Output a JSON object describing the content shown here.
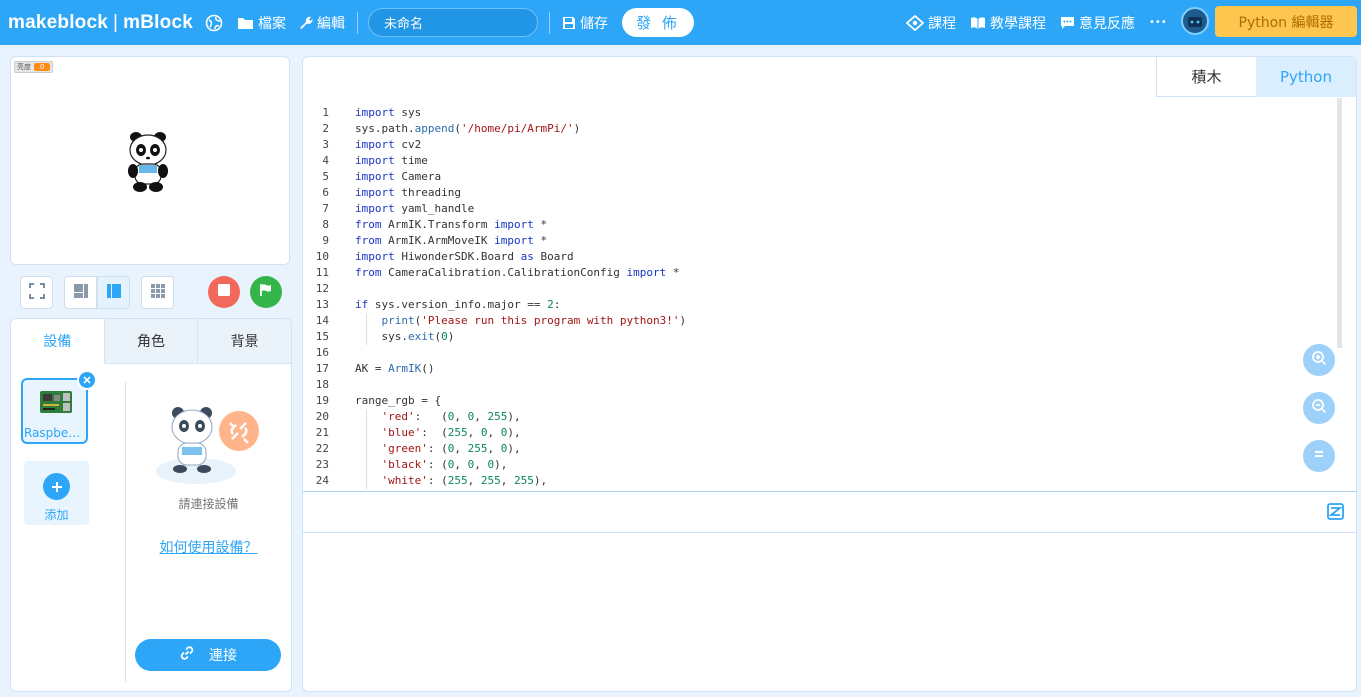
{
  "topbar": {
    "logo_brand": "makeblock",
    "logo_separator": "|",
    "logo_product": "mBlock",
    "file_label": "檔案",
    "edit_label": "編輯",
    "project_name": "未命名",
    "save_label": "儲存",
    "publish_label": "發 佈",
    "courses_label": "課程",
    "tutorials_label": "教學課程",
    "feedback_label": "意見反應",
    "more_label": "•••",
    "python_editor_label": "Python 編輯器",
    "accent_color": "#2ea6f7",
    "python_button_color": "#fcc64f"
  },
  "stage": {
    "variable_name": "亮度",
    "variable_value": "0"
  },
  "device_panel": {
    "tabs": [
      {
        "label": "設備",
        "active": true
      },
      {
        "label": "角色",
        "active": false
      },
      {
        "label": "背景",
        "active": false
      }
    ],
    "device_name": "Raspberr...",
    "add_label": "添加",
    "connect_hint": "請連接設備",
    "howto_link": "如何使用設備？",
    "connect_button": "連接"
  },
  "code_panel": {
    "mode_tabs": [
      "積木",
      "Python"
    ],
    "active_mode": "Python",
    "lines": [
      {
        "n": "1",
        "tokens": [
          [
            "kw",
            "import"
          ],
          [
            "t",
            " sys"
          ]
        ]
      },
      {
        "n": "2",
        "tokens": [
          [
            "t",
            "sys.path."
          ],
          [
            "fn",
            "append"
          ],
          [
            "t",
            "("
          ],
          [
            "str",
            "'/home/pi/ArmPi/'"
          ],
          [
            "t",
            ")"
          ]
        ]
      },
      {
        "n": "3",
        "tokens": [
          [
            "kw",
            "import"
          ],
          [
            "t",
            " cv2"
          ]
        ]
      },
      {
        "n": "4",
        "tokens": [
          [
            "kw",
            "import"
          ],
          [
            "t",
            " time"
          ]
        ]
      },
      {
        "n": "5",
        "tokens": [
          [
            "kw",
            "import"
          ],
          [
            "t",
            " Camera"
          ]
        ]
      },
      {
        "n": "6",
        "tokens": [
          [
            "kw",
            "import"
          ],
          [
            "t",
            " threading"
          ]
        ]
      },
      {
        "n": "7",
        "tokens": [
          [
            "kw",
            "import"
          ],
          [
            "t",
            " yaml_handle"
          ]
        ]
      },
      {
        "n": "8",
        "tokens": [
          [
            "kw",
            "from"
          ],
          [
            "t",
            " ArmIK.Transform "
          ],
          [
            "kw",
            "import"
          ],
          [
            "t",
            " *"
          ]
        ]
      },
      {
        "n": "9",
        "tokens": [
          [
            "kw",
            "from"
          ],
          [
            "t",
            " ArmIK.ArmMoveIK "
          ],
          [
            "kw",
            "import"
          ],
          [
            "t",
            " *"
          ]
        ]
      },
      {
        "n": "10",
        "tokens": [
          [
            "kw",
            "import"
          ],
          [
            "t",
            " HiwonderSDK.Board "
          ],
          [
            "kw",
            "as"
          ],
          [
            "t",
            " Board"
          ]
        ]
      },
      {
        "n": "11",
        "tokens": [
          [
            "kw",
            "from"
          ],
          [
            "t",
            " CameraCalibration.CalibrationConfig "
          ],
          [
            "kw",
            "import"
          ],
          [
            "t",
            " *"
          ]
        ]
      },
      {
        "n": "12",
        "tokens": []
      },
      {
        "n": "13",
        "tokens": [
          [
            "kw",
            "if"
          ],
          [
            "t",
            " sys.version_info.major == "
          ],
          [
            "num",
            "2"
          ],
          [
            "t",
            ":"
          ]
        ]
      },
      {
        "n": "14",
        "tokens": [
          [
            "t",
            "    "
          ],
          [
            "fn",
            "print"
          ],
          [
            "t",
            "("
          ],
          [
            "str",
            "'Please run this program with python3!'"
          ],
          [
            "t",
            ")"
          ]
        ]
      },
      {
        "n": "15",
        "tokens": [
          [
            "t",
            "    sys."
          ],
          [
            "fn",
            "exit"
          ],
          [
            "t",
            "("
          ],
          [
            "num",
            "0"
          ],
          [
            "t",
            ")"
          ]
        ]
      },
      {
        "n": "16",
        "tokens": []
      },
      {
        "n": "17",
        "tokens": [
          [
            "t",
            "AK = "
          ],
          [
            "fn",
            "ArmIK"
          ],
          [
            "t",
            "()"
          ]
        ]
      },
      {
        "n": "18",
        "tokens": []
      },
      {
        "n": "19",
        "tokens": [
          [
            "t",
            "range_rgb = {"
          ]
        ]
      },
      {
        "n": "20",
        "tokens": [
          [
            "t",
            "    "
          ],
          [
            "str",
            "'red'"
          ],
          [
            "t",
            ":   ("
          ],
          [
            "num",
            "0"
          ],
          [
            "t",
            ", "
          ],
          [
            "num",
            "0"
          ],
          [
            "t",
            ", "
          ],
          [
            "num",
            "255"
          ],
          [
            "t",
            "),"
          ]
        ]
      },
      {
        "n": "21",
        "tokens": [
          [
            "t",
            "    "
          ],
          [
            "str",
            "'blue'"
          ],
          [
            "t",
            ":  ("
          ],
          [
            "num",
            "255"
          ],
          [
            "t",
            ", "
          ],
          [
            "num",
            "0"
          ],
          [
            "t",
            ", "
          ],
          [
            "num",
            "0"
          ],
          [
            "t",
            "),"
          ]
        ]
      },
      {
        "n": "22",
        "tokens": [
          [
            "t",
            "    "
          ],
          [
            "str",
            "'green'"
          ],
          [
            "t",
            ": ("
          ],
          [
            "num",
            "0"
          ],
          [
            "t",
            ", "
          ],
          [
            "num",
            "255"
          ],
          [
            "t",
            ", "
          ],
          [
            "num",
            "0"
          ],
          [
            "t",
            "),"
          ]
        ]
      },
      {
        "n": "23",
        "tokens": [
          [
            "t",
            "    "
          ],
          [
            "str",
            "'black'"
          ],
          [
            "t",
            ": ("
          ],
          [
            "num",
            "0"
          ],
          [
            "t",
            ", "
          ],
          [
            "num",
            "0"
          ],
          [
            "t",
            ", "
          ],
          [
            "num",
            "0"
          ],
          [
            "t",
            "),"
          ]
        ]
      },
      {
        "n": "24",
        "tokens": [
          [
            "t",
            "    "
          ],
          [
            "str",
            "'white'"
          ],
          [
            "t",
            ": ("
          ],
          [
            "num",
            "255"
          ],
          [
            "t",
            ", "
          ],
          [
            "num",
            "255"
          ],
          [
            "t",
            ", "
          ],
          [
            "num",
            "255"
          ],
          [
            "t",
            "),"
          ]
        ]
      }
    ]
  }
}
